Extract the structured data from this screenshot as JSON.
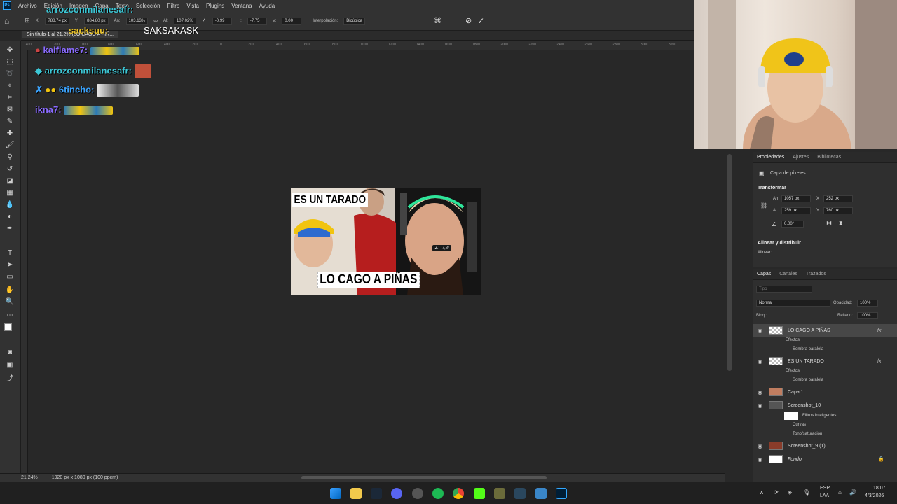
{
  "menu": {
    "items": [
      "Archivo",
      "Edición",
      "Imagen",
      "Capa",
      "Texto",
      "Selección",
      "Filtro",
      "Vista",
      "Plugins",
      "Ventana",
      "Ayuda"
    ]
  },
  "options": {
    "x_label": "X:",
    "x_value": "788,74 px",
    "y_label": "Y:",
    "y_value": "884,80 px",
    "w_label": "An:",
    "w_value": "103,13%",
    "h_label": "Al:",
    "h_value": "107,02%",
    "angle_value": "-0,99",
    "hskew_label": "H:",
    "hskew_value": "-7,75",
    "vskew_label": "V:",
    "vskew_value": "0,00",
    "interp_label": "Interpolación:",
    "interp_value": "Bicúbica"
  },
  "document": {
    "tab_title": "Sin título-1 al 21,2% (LO CAGO A PIÑ...",
    "zoom": "21,24%",
    "size": "1920 px x 1080 px (100 ppcm)",
    "rotate_readout": "∠: -7,8°",
    "caption_top": "ES UN TARADO",
    "caption_bottom": "LO CAGO A PIÑAS"
  },
  "ruler": {
    "ticks": [
      "1400",
      "1200",
      "1000",
      "800",
      "600",
      "400",
      "200",
      "0",
      "200",
      "400",
      "600",
      "800",
      "1000",
      "1200",
      "1400",
      "1600",
      "1800",
      "2000",
      "2200",
      "2400",
      "2600",
      "2800",
      "3000",
      "3200"
    ]
  },
  "chat": {
    "top_user": "arrozconmilanesafr:",
    "banner": "SAKSAKASK",
    "lines": [
      {
        "user": "sacksuu:",
        "color": "#e8c12a"
      },
      {
        "user": "kaiflame7:",
        "color": "#8a6bff"
      },
      {
        "user": "arrozconmilanesafr:",
        "color": "#3cc7d6"
      },
      {
        "user": "6tincho:",
        "color": "#3ba4ff"
      },
      {
        "user": "ikna7:",
        "color": "#8a6bff"
      }
    ]
  },
  "properties": {
    "tabs": [
      "Propiedades",
      "Ajustes",
      "Bibliotecas"
    ],
    "type": "Capa de píxeles",
    "transform_title": "Transformar",
    "w_label": "An",
    "w_value": "1057 px",
    "x_label": "X",
    "x_value": "252 px",
    "h_label": "Al",
    "h_value": "259 px",
    "y_label": "Y",
    "y_value": "760 px",
    "angle_value": "0,00°",
    "align_title": "Alinear y distribuir",
    "align_label": "Alinear:"
  },
  "layers": {
    "tabs": [
      "Capas",
      "Canales",
      "Trazados"
    ],
    "search_placeholder": "Tipo",
    "blend": "Normal",
    "opacity_label": "Opacidad:",
    "opacity_value": "100%",
    "lock_label": "Bloq.:",
    "fill_label": "Relleno:",
    "fill_value": "100%",
    "items": [
      {
        "name": "LO CAGO A PIÑAS",
        "fx": "fx"
      },
      {
        "name": "Efectos"
      },
      {
        "name": "Sombra paralela"
      },
      {
        "name": "ES UN TARADO",
        "fx": "fx"
      },
      {
        "name": "Efectos"
      },
      {
        "name": "Sombra paralela"
      },
      {
        "name": "Capa 1"
      },
      {
        "name": "Screenshot_10"
      },
      {
        "name": "Filtros inteligentes"
      },
      {
        "name": "Curvas"
      },
      {
        "name": "Tono/saturación"
      },
      {
        "name": "Screenshot_9 (1)"
      },
      {
        "name": "Fondo"
      }
    ]
  },
  "taskbar": {
    "lang": "ESP",
    "region": "LAA",
    "time": "18:07",
    "date": "4/3/2026"
  }
}
